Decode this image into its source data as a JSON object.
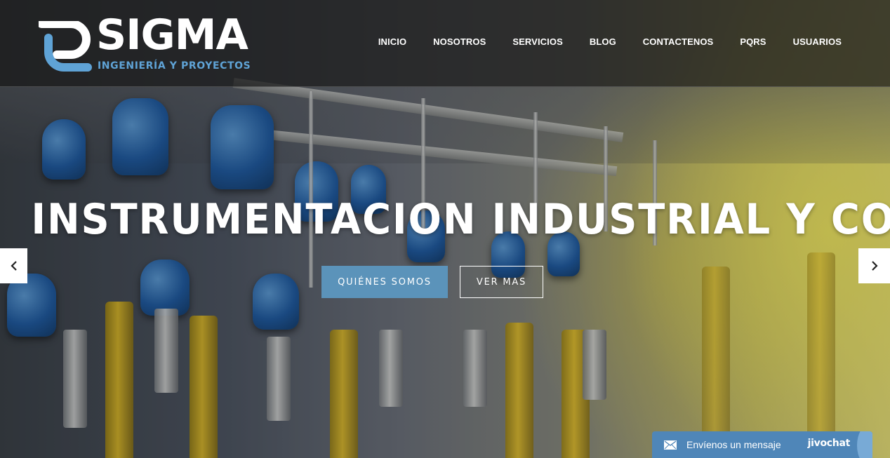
{
  "brand": {
    "name": "SIGMA",
    "tagline": "INGENIERÍA Y PROYECTOS",
    "accent_color": "#5fa3d6"
  },
  "nav": {
    "items": [
      {
        "label": "INICIO"
      },
      {
        "label": "NOSOTROS"
      },
      {
        "label": "SERVICIOS"
      },
      {
        "label": "BLOG"
      },
      {
        "label": "CONTACTENOS"
      },
      {
        "label": "PQRS"
      },
      {
        "label": "USUARIOS"
      }
    ]
  },
  "hero": {
    "headline": "INSTRUMENTACION INDUSTRIAL Y CONTROL",
    "primary_cta": "QUIÉNES SOMOS",
    "secondary_cta": "VER MAS",
    "primary_color": "#5b93ba",
    "prev_icon": "chevron-left-icon",
    "next_icon": "chevron-right-icon"
  },
  "chat": {
    "label": "Envíenos un mensaje",
    "brand": "jivochat",
    "icon": "mail-icon",
    "color": "#4f86b8"
  }
}
